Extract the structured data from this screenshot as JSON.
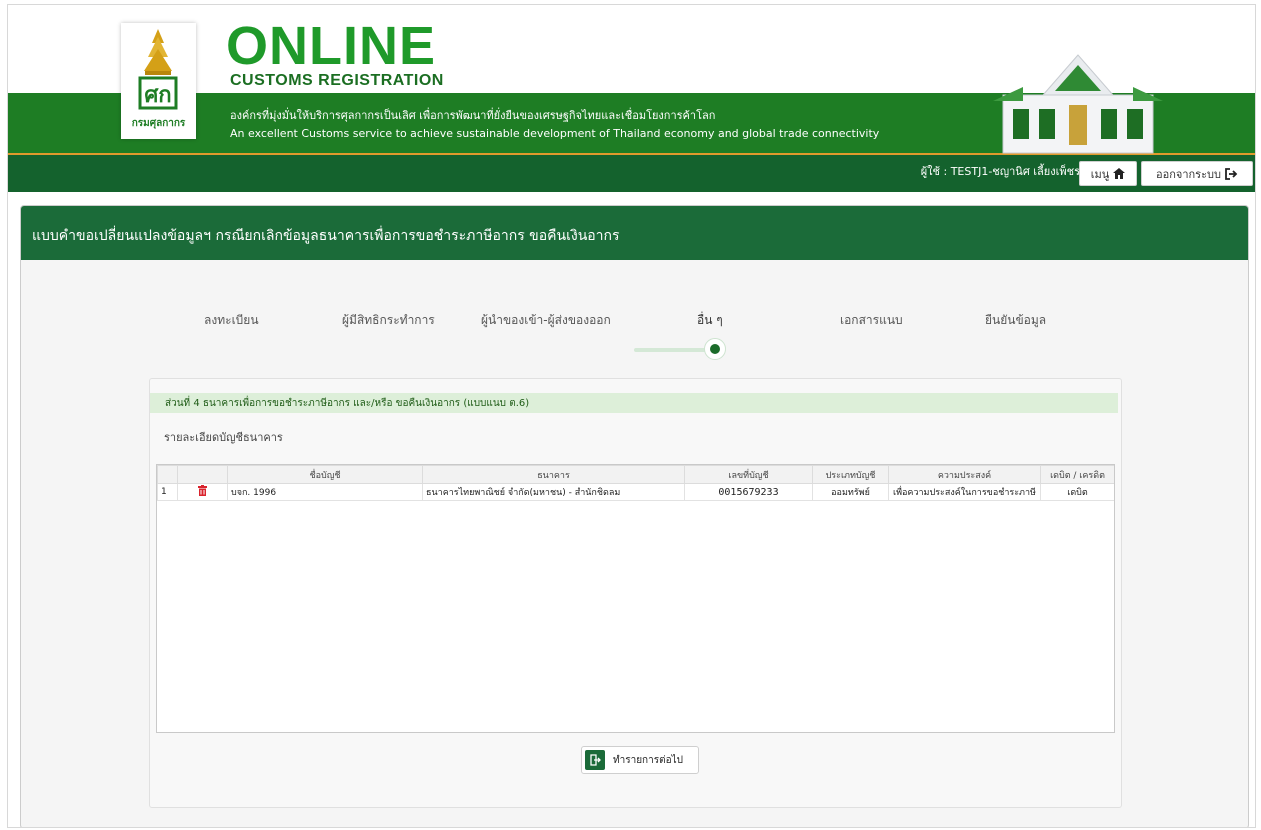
{
  "header": {
    "logo_text": "กรมศุลกากร",
    "brand_title": "ONLINE",
    "brand_subtitle": "CUSTOMS REGISTRATION",
    "tagline_th": "องค์กรที่มุ่งมั่นให้บริการศุลกากรเป็นเลิศ เพื่อการพัฒนาที่ยั่งยืนของเศรษฐกิจไทยและเชื่อมโยงการค้าโลก",
    "tagline_en": "An excellent Customs service to achieve sustainable development of Thailand economy and global trade connectivity",
    "user_label": "ผู้ใช้ : TESTJ1-ชญานิศ เลี้ยงเพ็ชร",
    "menu_label": "เมนู",
    "logout_label": "ออกจากระบบ"
  },
  "panel": {
    "title": "แบบคำขอเปลี่ยนแปลงข้อมูลฯ กรณียกเลิกข้อมูลธนาคารเพื่อการขอชำระภาษีอากร ขอคืนเงินอากร"
  },
  "steps": [
    "ลงทะเบียน",
    "ผู้มีสิทธิกระทำการ",
    "ผู้นำของเข้า-ผู้ส่งของออก",
    "อื่น ๆ",
    "เอกสารแนบ",
    "ยืนยันข้อมูล"
  ],
  "section": {
    "title": "ส่วนที่ 4 ธนาคารเพื่อการขอชำระภาษีอากร และ/หรือ ขอคืนเงินอากร (แบบแนบ ต.6)",
    "subtitle": "รายละเอียดบัญชีธนาคาร"
  },
  "table": {
    "headers": [
      "",
      "",
      "ชื่อบัญชี",
      "ธนาคาร",
      "เลขที่บัญชี",
      "ประเภทบัญชี",
      "ความประสงค์",
      "เดบิต / เครดิต"
    ],
    "rows": [
      {
        "no": "1",
        "account_name": "บจก. 1996",
        "bank": "ธนาคารไทยพาณิชย์ จำกัด(มหาชน) - สำนักชิดลม",
        "account_no": "0015679233",
        "account_type": "ออมทรัพย์",
        "purpose": "เพื่อความประสงค์ในการขอชำระภาษี",
        "debit_credit": "เดบิต"
      }
    ]
  },
  "actions": {
    "next_label": "ทำรายการต่อไป"
  },
  "colors": {
    "header_green": "#1e7d24",
    "nav_dark_green": "#14622d",
    "panel_head": "#1b6b39",
    "accent_orange": "#e09a2c",
    "delete_red": "#d9232d"
  }
}
